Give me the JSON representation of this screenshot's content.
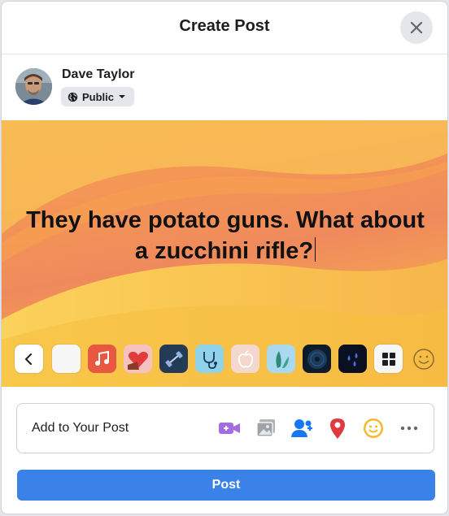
{
  "dialog": {
    "title": "Create Post"
  },
  "user": {
    "name": "Dave Taylor",
    "privacy": "Public"
  },
  "post": {
    "text": "They have potato guns. What about a zucchini rifle?"
  },
  "backgrounds": {
    "items": [
      {
        "name": "back-arrow-swatch",
        "icon": "chevron-left-icon"
      },
      {
        "name": "plain-white-swatch",
        "icon": "none"
      },
      {
        "name": "music-swatch",
        "icon": "music-note-icon",
        "color": "#e8573f"
      },
      {
        "name": "heart-swatch",
        "icon": "heart-icon",
        "color": "#f6c2c0"
      },
      {
        "name": "dumbbell-swatch",
        "icon": "dumbbell-icon",
        "color": "#243b55"
      },
      {
        "name": "stethoscope-swatch",
        "icon": "stethoscope-icon",
        "color": "#8fd3ea"
      },
      {
        "name": "apple-swatch",
        "icon": "apple-icon",
        "color": "#f4d7cd"
      },
      {
        "name": "leaf-swatch",
        "icon": "leaf-icon",
        "color": "#a9d8ef"
      },
      {
        "name": "vinyl-swatch",
        "icon": "vinyl-record-icon",
        "color": "#0d1b2a"
      },
      {
        "name": "rain-swatch",
        "icon": "raindrops-icon",
        "color": "#0b1020"
      },
      {
        "name": "more-swatch",
        "icon": "grid-icon"
      }
    ]
  },
  "add_to_post": {
    "label": "Add to Your Post",
    "icons": [
      "video-camera-icon",
      "photo-icon",
      "tag-people-icon",
      "location-pin-icon",
      "feeling-smiley-icon",
      "more-dots-icon"
    ]
  },
  "actions": {
    "post_label": "Post"
  },
  "colors": {
    "accent": "#3b82e8",
    "canvas_top": "#f79a4a",
    "canvas_bottom": "#f8c948"
  }
}
